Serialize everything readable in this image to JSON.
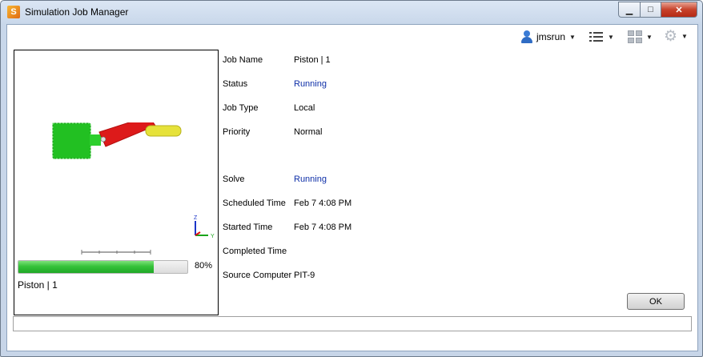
{
  "window": {
    "title": "Simulation Job Manager",
    "app_icon_glyph": "S",
    "minimize_glyph": "▁",
    "maximize_glyph": "□",
    "close_glyph": "✕"
  },
  "toolbar": {
    "user": "jmsrun",
    "dropdown_glyph": "▼",
    "gear_glyph": "⚙",
    "icons": [
      "user-icon",
      "list-view-icon",
      "layout-icon",
      "gear-icon"
    ]
  },
  "preview": {
    "progress_percent": 80,
    "progress_label": "80%",
    "job_label": "Piston | 1",
    "axis_labels": {
      "z": "Z",
      "y": "Y"
    }
  },
  "details": {
    "job_name": {
      "label": "Job Name",
      "value": "Piston | 1"
    },
    "status": {
      "label": "Status",
      "value": "Running"
    },
    "job_type": {
      "label": "Job Type",
      "value": "Local"
    },
    "priority": {
      "label": "Priority",
      "value": "Normal"
    },
    "solve": {
      "label": "Solve",
      "value": "Running"
    },
    "scheduled_time": {
      "label": "Scheduled Time",
      "value": "Feb 7 4:08 PM"
    },
    "started_time": {
      "label": "Started Time",
      "value": "Feb 7 4:08 PM"
    },
    "completed_time": {
      "label": "Completed Time",
      "value": ""
    },
    "source_computer": {
      "label": "Source Computer",
      "value": "PIT-9"
    }
  },
  "buttons": {
    "ok": "OK"
  },
  "colors": {
    "running_text": "#0e2fa8",
    "progress_fill": "#36c23a",
    "piston_green": "#22c022",
    "rod_red": "#dd1a1a",
    "crank_yellow": "#e6e23a"
  }
}
